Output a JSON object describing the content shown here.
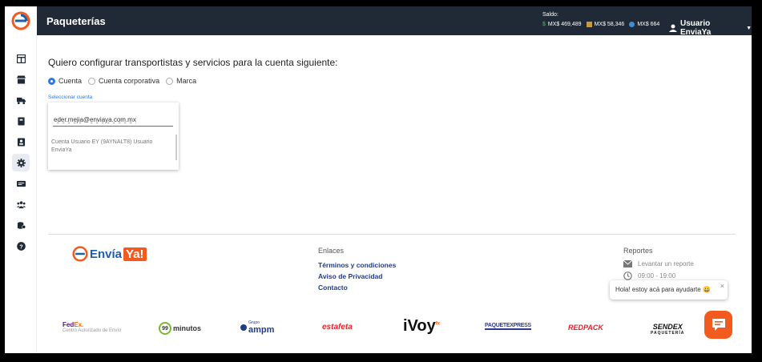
{
  "topbar": {
    "title": "Paqueterías",
    "saldo_label": "Saldo:",
    "balances": [
      {
        "icon": "dollar-icon",
        "value": "MX$ 469,489",
        "color": "#3aa657"
      },
      {
        "icon": "flag-icon",
        "value": "MX$ 58,346",
        "color": "#c99a3a"
      },
      {
        "icon": "globe-icon",
        "value": "MX$ 664",
        "color": "#3a8fd6"
      }
    ],
    "user_label": "Usuario EnviaYa"
  },
  "sidebar": {
    "items": [
      {
        "icon": "dashboard-icon"
      },
      {
        "icon": "store-icon"
      },
      {
        "icon": "truck-icon"
      },
      {
        "icon": "package-icon"
      },
      {
        "icon": "contacts-icon"
      },
      {
        "icon": "gear-icon",
        "active": true
      },
      {
        "icon": "invoice-icon"
      },
      {
        "icon": "users-icon"
      },
      {
        "icon": "coins-icon"
      },
      {
        "icon": "help-icon"
      }
    ]
  },
  "main": {
    "heading": "Quiero configurar transportistas y servicios para la cuenta siguiente:",
    "radio_options": [
      {
        "label": "Cuenta",
        "checked": true
      },
      {
        "label": "Cuenta corporativa",
        "checked": false
      },
      {
        "label": "Marca",
        "checked": false
      }
    ],
    "select_label": "Seleccionar cuenta",
    "account_input_value": "eder.mejia@enviaya.com.mx",
    "account_option": "Cuenta Usuario EY (9AYNALT8) Usuario EnviaYa"
  },
  "footer": {
    "logo_text_1": "Envía",
    "logo_text_2": "Ya!",
    "links_title": "Enlaces",
    "links": [
      "Términos y condiciones",
      "Aviso de Privacidad",
      "Contacto"
    ],
    "reports_title": "Reportes",
    "report_link": "Levantar un reporte",
    "hours": "09:00 - 19:00",
    "carriers": {
      "fedex_1": "Fed",
      "fedex_2": "Ex.",
      "fedex_sub": "Centro Autorizado de Envío",
      "nm_number": "99",
      "nm_text": "minutos",
      "ampm_group": "Grupo",
      "ampm": "ampm",
      "estafeta": "estafeta",
      "ivoy": "iVoy",
      "ivoy_sup": "fx",
      "paquetexpress": "PAQUETEXPRESS",
      "redpack": "REDPACK",
      "sendex": "SENDEX",
      "sendex_sub": "PAQUETERÍA"
    }
  },
  "chat": {
    "bubble_text": "Hola! estoy acá para ayudarte 😀",
    "close": "×"
  },
  "colors": {
    "topbar_bg": "#1f2a36",
    "accent_blue": "#2a7ae2",
    "brand_orange": "#f25a1e",
    "link_navy": "#1f3c88"
  }
}
